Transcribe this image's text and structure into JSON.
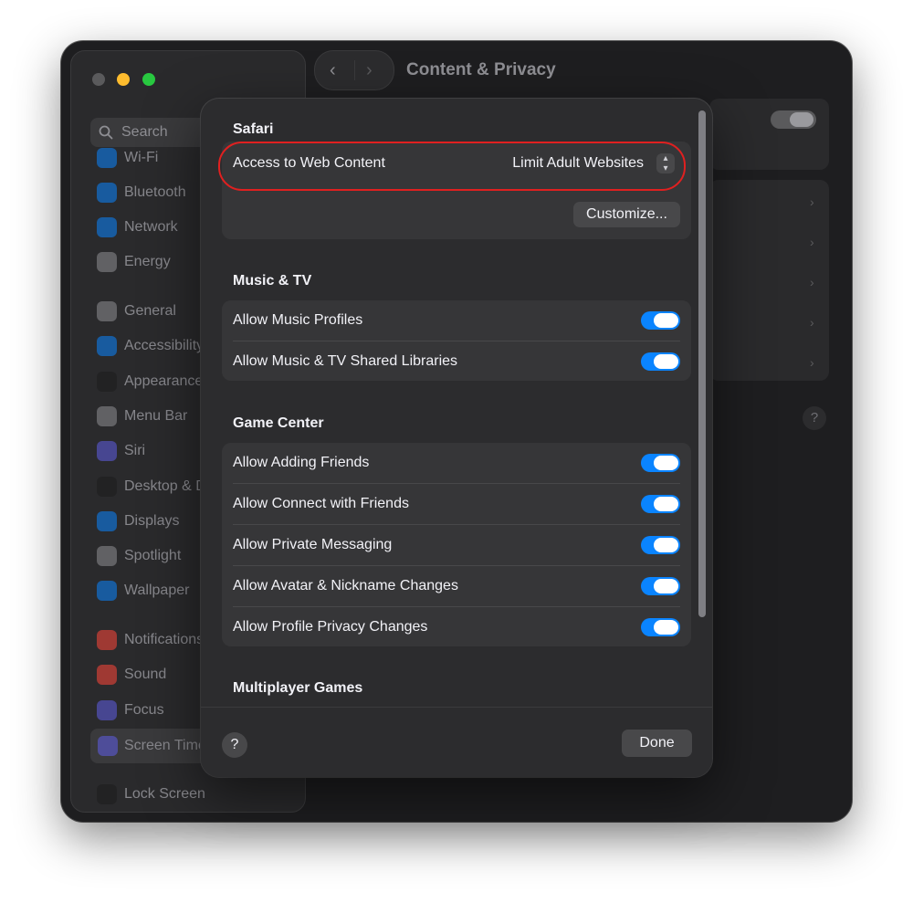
{
  "window": {
    "title": "Content & Privacy"
  },
  "sidebar": {
    "search_placeholder": "Search",
    "items": [
      {
        "label": "Wi-Fi",
        "icon": "wifi-icon",
        "color": "#0a84ff"
      },
      {
        "label": "Bluetooth",
        "icon": "bluetooth-icon",
        "color": "#0a84ff"
      },
      {
        "label": "Network",
        "icon": "globe-icon",
        "color": "#0a84ff"
      },
      {
        "label": "Energy",
        "icon": "bolt-icon",
        "color": "#8e8e93"
      },
      {
        "label": "General",
        "icon": "gear-icon",
        "color": "#8e8e93"
      },
      {
        "label": "Accessibility",
        "icon": "accessibility-icon",
        "color": "#0a84ff"
      },
      {
        "label": "Appearance",
        "icon": "appearance-icon",
        "color": "#1c1c1e"
      },
      {
        "label": "Menu Bar",
        "icon": "menu-bar-icon",
        "color": "#8e8e93"
      },
      {
        "label": "Siri",
        "icon": "siri-icon",
        "color": "#5e5ce6"
      },
      {
        "label": "Desktop & Do",
        "icon": "desktop-icon",
        "color": "#1c1c1e"
      },
      {
        "label": "Displays",
        "icon": "displays-icon",
        "color": "#0a84ff"
      },
      {
        "label": "Spotlight",
        "icon": "spotlight-icon",
        "color": "#8e8e93"
      },
      {
        "label": "Wallpaper",
        "icon": "wallpaper-icon",
        "color": "#0a84ff"
      },
      {
        "label": "Notifications",
        "icon": "bell-icon",
        "color": "#ff453a"
      },
      {
        "label": "Sound",
        "icon": "speaker-icon",
        "color": "#ff453a"
      },
      {
        "label": "Focus",
        "icon": "moon-icon",
        "color": "#5e5ce6"
      },
      {
        "label": "Screen Time",
        "icon": "hourglass-icon",
        "color": "#5e5ce6"
      },
      {
        "label": "Lock Screen",
        "icon": "lock-icon",
        "color": "#1c1c1e"
      }
    ]
  },
  "dialog": {
    "sections": {
      "safari": {
        "title": "Safari",
        "web_content_label": "Access to Web Content",
        "web_content_value": "Limit Adult Websites",
        "customize_label": "Customize..."
      },
      "music": {
        "title": "Music & TV",
        "rows": [
          {
            "label": "Allow Music Profiles",
            "on": true
          },
          {
            "label": "Allow Music & TV Shared Libraries",
            "on": true
          }
        ]
      },
      "game_center": {
        "title": "Game Center",
        "rows": [
          {
            "label": "Allow Adding Friends",
            "on": true
          },
          {
            "label": "Allow Connect with Friends",
            "on": true
          },
          {
            "label": "Allow Private Messaging",
            "on": true
          },
          {
            "label": "Allow Avatar & Nickname Changes",
            "on": true
          },
          {
            "label": "Allow Profile Privacy Changes",
            "on": true
          }
        ]
      },
      "multiplayer": {
        "title": "Multiplayer Games"
      }
    },
    "help_label": "?",
    "done_label": "Done",
    "highlight_color": "#e02020",
    "toggle_color": "#0a84ff"
  },
  "background": {
    "help_label": "?"
  }
}
